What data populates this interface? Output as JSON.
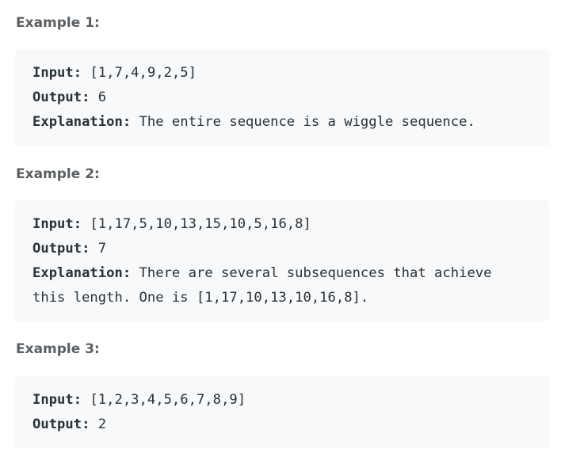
{
  "examples": [
    {
      "heading": "Example 1:",
      "input_label": "Input:",
      "input_value": " [1,7,4,9,2,5]",
      "output_label": "Output:",
      "output_value": " 6",
      "explanation_label": "Explanation:",
      "explanation_lines": [
        " The entire sequence is a wiggle sequence."
      ]
    },
    {
      "heading": "Example 2:",
      "input_label": "Input:",
      "input_value": " [1,17,5,10,13,15,10,5,16,8]",
      "output_label": "Output:",
      "output_value": " 7",
      "explanation_label": "Explanation:",
      "explanation_lines": [
        " There are several subsequences that achieve",
        "this length. One is [1,17,10,13,10,16,8]."
      ]
    },
    {
      "heading": "Example 3:",
      "input_label": "Input:",
      "input_value": " [1,2,3,4,5,6,7,8,9]",
      "output_label": "Output:",
      "output_value": " 2"
    }
  ]
}
